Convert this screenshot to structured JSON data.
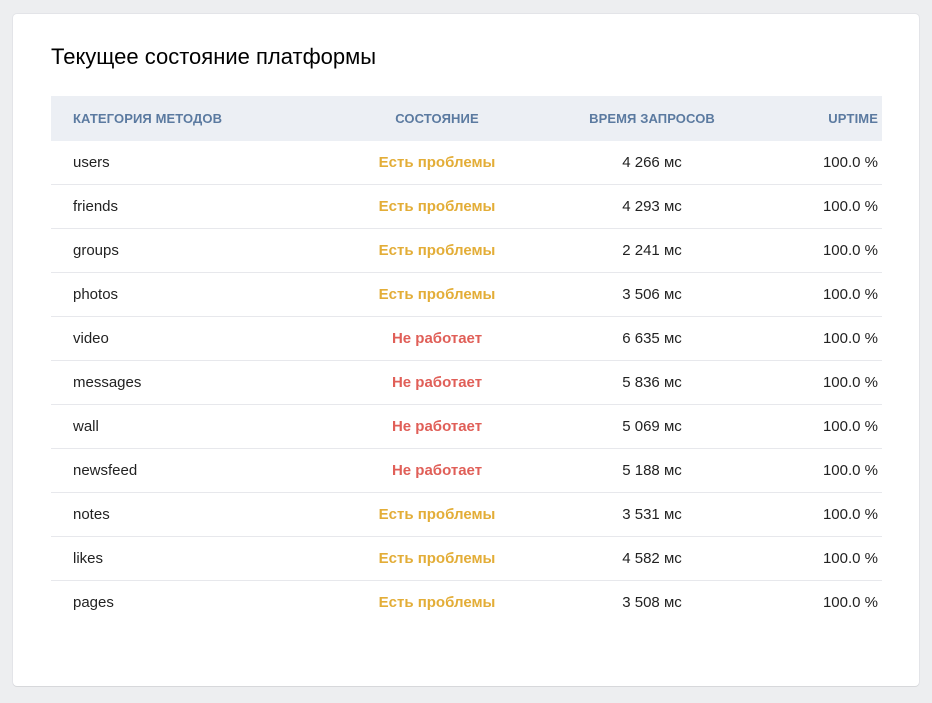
{
  "title": "Текущее состояние платформы",
  "colors": {
    "warning": "#e3ad37",
    "down": "#e05f58",
    "header_text": "#5b7aa0"
  },
  "columns": {
    "category": "КАТЕГОРИЯ МЕТОДОВ",
    "status": "СОСТОЯНИЕ",
    "response_time": "ВРЕМЯ ЗАПРОСОВ",
    "uptime": "UPTIME"
  },
  "rows": [
    {
      "category": "users",
      "status": "Есть проблемы",
      "level": "warn",
      "time": "4 266 мс",
      "uptime": "100.0 %"
    },
    {
      "category": "friends",
      "status": "Есть проблемы",
      "level": "warn",
      "time": "4 293 мс",
      "uptime": "100.0 %"
    },
    {
      "category": "groups",
      "status": "Есть проблемы",
      "level": "warn",
      "time": "2 241 мс",
      "uptime": "100.0 %"
    },
    {
      "category": "photos",
      "status": "Есть проблемы",
      "level": "warn",
      "time": "3 506 мс",
      "uptime": "100.0 %"
    },
    {
      "category": "video",
      "status": "Не работает",
      "level": "down",
      "time": "6 635 мс",
      "uptime": "100.0 %"
    },
    {
      "category": "messages",
      "status": "Не работает",
      "level": "down",
      "time": "5 836 мс",
      "uptime": "100.0 %"
    },
    {
      "category": "wall",
      "status": "Не работает",
      "level": "down",
      "time": "5 069 мс",
      "uptime": "100.0 %"
    },
    {
      "category": "newsfeed",
      "status": "Не работает",
      "level": "down",
      "time": "5 188 мс",
      "uptime": "100.0 %"
    },
    {
      "category": "notes",
      "status": "Есть проблемы",
      "level": "warn",
      "time": "3 531 мс",
      "uptime": "100.0 %"
    },
    {
      "category": "likes",
      "status": "Есть проблемы",
      "level": "warn",
      "time": "4 582 мс",
      "uptime": "100.0 %"
    },
    {
      "category": "pages",
      "status": "Есть проблемы",
      "level": "warn",
      "time": "3 508 мс",
      "uptime": "100.0 %"
    }
  ]
}
